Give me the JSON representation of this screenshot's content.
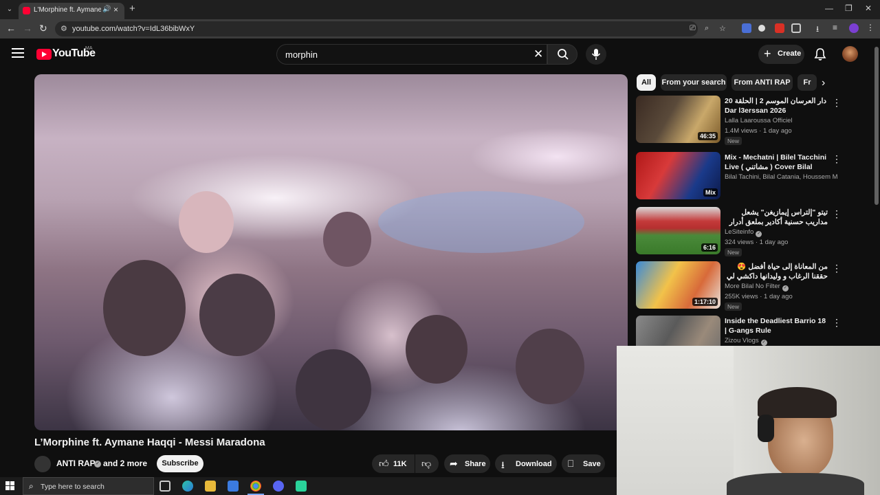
{
  "browser": {
    "tab_title": "L'Morphine ft. Aymane Haqi",
    "url": "youtube.com/watch?v=IdL36bibWxY",
    "window_controls": {
      "minimize": "—",
      "restore": "❐",
      "close": "✕"
    }
  },
  "youtube": {
    "logo_text": "YouTube",
    "region": "MA",
    "search_value": "morphin",
    "create_label": "Create"
  },
  "video": {
    "title": "L’Morphine ft. Aymane Haqqi - Messi Maradona",
    "channel": "ANTI RAP",
    "and_more": "and 2 more",
    "subscribe_label": "Subscribe",
    "likes": "11K",
    "share_label": "Share",
    "download_label": "Download",
    "save_label": "Save"
  },
  "chips": [
    "All",
    "From your search",
    "From ANTI RAP",
    "Fr"
  ],
  "recommendations": [
    {
      "title": "دار العرسان الموسم 2 | الحلقة 20 Dar l3erssan 2026",
      "channel": "Lalla Laaroussa Officiel",
      "meta": "1.4M views · 1 day ago",
      "duration": "46:35",
      "badge": "New",
      "verified": false
    },
    {
      "title": "Mix - Mechatni | Bilel Tacchini Live ( مشاتني ) Cover Bilal Catania",
      "channel": "Bilal Tachini, Bilal Catania, Houssem Ma...",
      "meta": "",
      "duration": "Mix",
      "badge": "",
      "verified": false
    },
    {
      "title": "تيتو \"إلتراس إيمازيغن\" يشعل مداريب حسنية أكادير بملعق أدرار وحوار مباشر بين ...",
      "channel": "LeSiteinfo",
      "meta": "324 views · 1 day ago",
      "duration": "6:16",
      "badge": "New",
      "verified": true
    },
    {
      "title": "من المعاناة إلى حياة أفضل 😍 حققنا الرغاب و وليدانها داكشي لي كافت كانحلم بيه",
      "channel": "More Bilal No Filter",
      "meta": "255K views · 1 day ago",
      "duration": "1:17:10",
      "badge": "New",
      "verified": true
    },
    {
      "title": "Inside the Deadliest Barrio 18 | G-angs Rule",
      "channel": "Zizou Vlogs",
      "meta": "",
      "duration": "",
      "badge": "",
      "verified": true
    }
  ],
  "taskbar": {
    "search_placeholder": "Type here to search"
  },
  "colors": {
    "yt_red": "#ff0033",
    "background": "#0f0f0f",
    "chip_bg": "#272727"
  }
}
